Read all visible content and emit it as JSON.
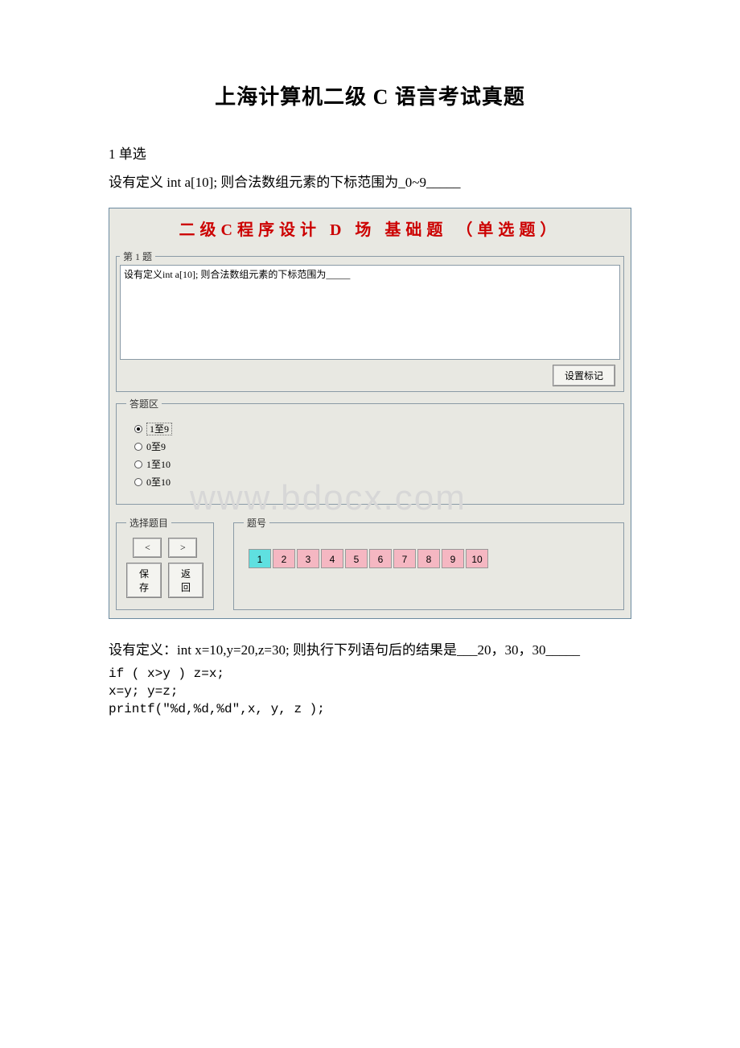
{
  "doc": {
    "title": "上海计算机二级 C 语言考试真题",
    "section1_label": "1 单选",
    "q1_intro": "设有定义 int a[10]; 则合法数组元素的下标范围为_0~9_____",
    "q2_intro_pre": "设有定义：int x=10,y=20,z=30; 则执行下列语句后的结果是___20，30，30_____",
    "code_line1": "if ( x>y ) z=x;",
    "code_line2": "x=y; y=z;",
    "code_line3": "printf(\"%d,%d,%d\",x, y, z );"
  },
  "app": {
    "title": "二级C程序设计  D  场  基础题 （单选题）",
    "question_legend": "第 1 题",
    "question_text": "设有定义int a[10]; 则合法数组元素的下标范围为_____",
    "mark_btn": "设置标记",
    "answer_legend": "答题区",
    "answers": [
      "1至9",
      "0至9",
      "1至10",
      "0至10"
    ],
    "selected_answer_index": 0,
    "select_q_legend": "选择题目",
    "prev_btn": "<",
    "next_btn": ">",
    "save_btn": "保存",
    "back_btn": "返回",
    "num_legend": "题号",
    "numbers": [
      "1",
      "2",
      "3",
      "4",
      "5",
      "6",
      "7",
      "8",
      "9",
      "10"
    ],
    "tile_colors": {
      "current": "#5fe0e0",
      "done": "#f5b7c2",
      "default": "#f2f2ee"
    },
    "current_index": 0,
    "done_indices": [
      1,
      2,
      3,
      4,
      5,
      6,
      7,
      8,
      9
    ]
  },
  "watermark": "www.bdocx.com"
}
